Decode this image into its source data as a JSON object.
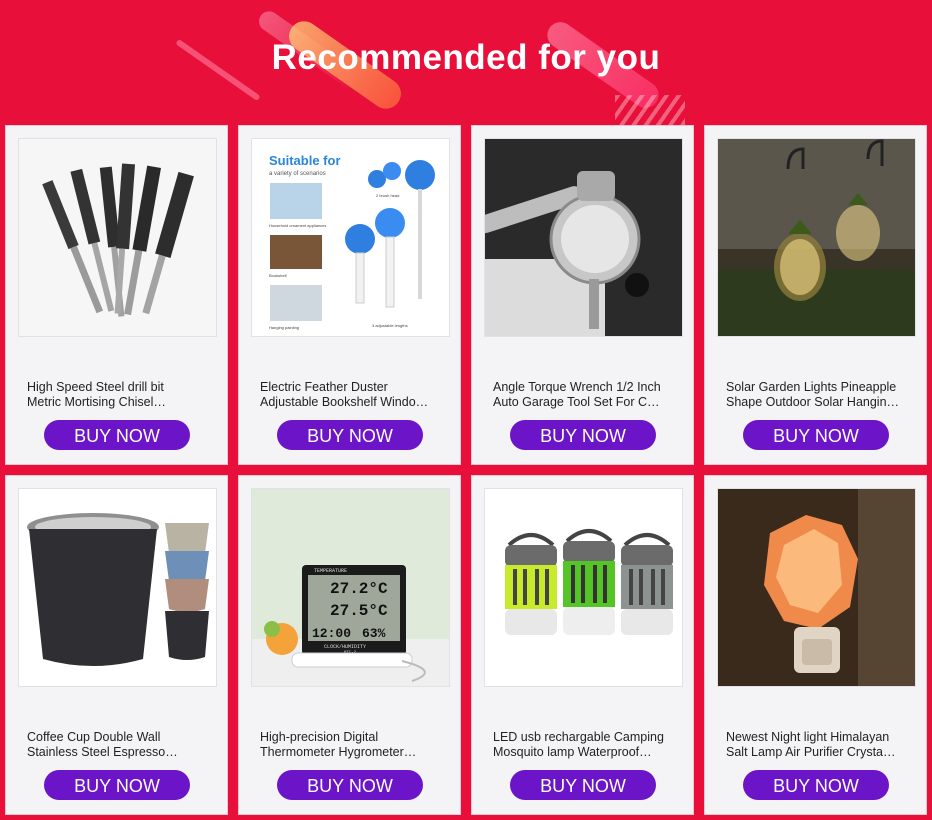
{
  "header": {
    "title": "Recommended for you"
  },
  "products": [
    {
      "title": "High Speed Steel drill bit\nMetric Mortising Chisel…",
      "button": "BUY NOW",
      "icon": "drill-bits-image"
    },
    {
      "title": "Electric Feather Duster\nAdjustable Bookshelf Windo…",
      "button": "BUY NOW",
      "icon": "feather-duster-image",
      "img_text": {
        "headline": "Suitable for",
        "sub": "a variety of scenarios",
        "c1": "Household ornament appliances",
        "c2": "Bookshelf",
        "c3": "Hanging painting",
        "d1": "2 brush head",
        "d2": "3 adjustable lengths"
      }
    },
    {
      "title": "Angle Torque Wrench 1/2 Inch\nAuto Garage Tool Set For C…",
      "button": "BUY NOW",
      "icon": "torque-wrench-image"
    },
    {
      "title": "Solar Garden Lights Pineapple\nShape Outdoor Solar Hangin…",
      "button": "BUY NOW",
      "icon": "solar-lights-image"
    },
    {
      "title": "Coffee Cup Double Wall\nStainless Steel Espresso…",
      "button": "BUY NOW",
      "icon": "coffee-cups-image"
    },
    {
      "title": "High-precision Digital\nThermometer Hygrometer…",
      "button": "BUY NOW",
      "icon": "thermometer-image",
      "img_text": {
        "label": "TEMPERATURE",
        "t1": "27.2°C",
        "t2": "27.5°C",
        "time": "12:00",
        "hum": "63%",
        "clock": "CLOCK/HUMIDITY",
        "model": "HTC-2"
      }
    },
    {
      "title": "LED usb rechargable Camping\nMosquito lamp Waterproof…",
      "button": "BUY NOW",
      "icon": "mosquito-lamp-image"
    },
    {
      "title": "Newest Night light Himalayan\nSalt Lamp Air Purifier Crysta…",
      "button": "BUY NOW",
      "icon": "salt-lamp-image"
    }
  ],
  "colors": {
    "background": "#e8103a",
    "button": "#6c15c8",
    "card": "#f4f4f6"
  }
}
